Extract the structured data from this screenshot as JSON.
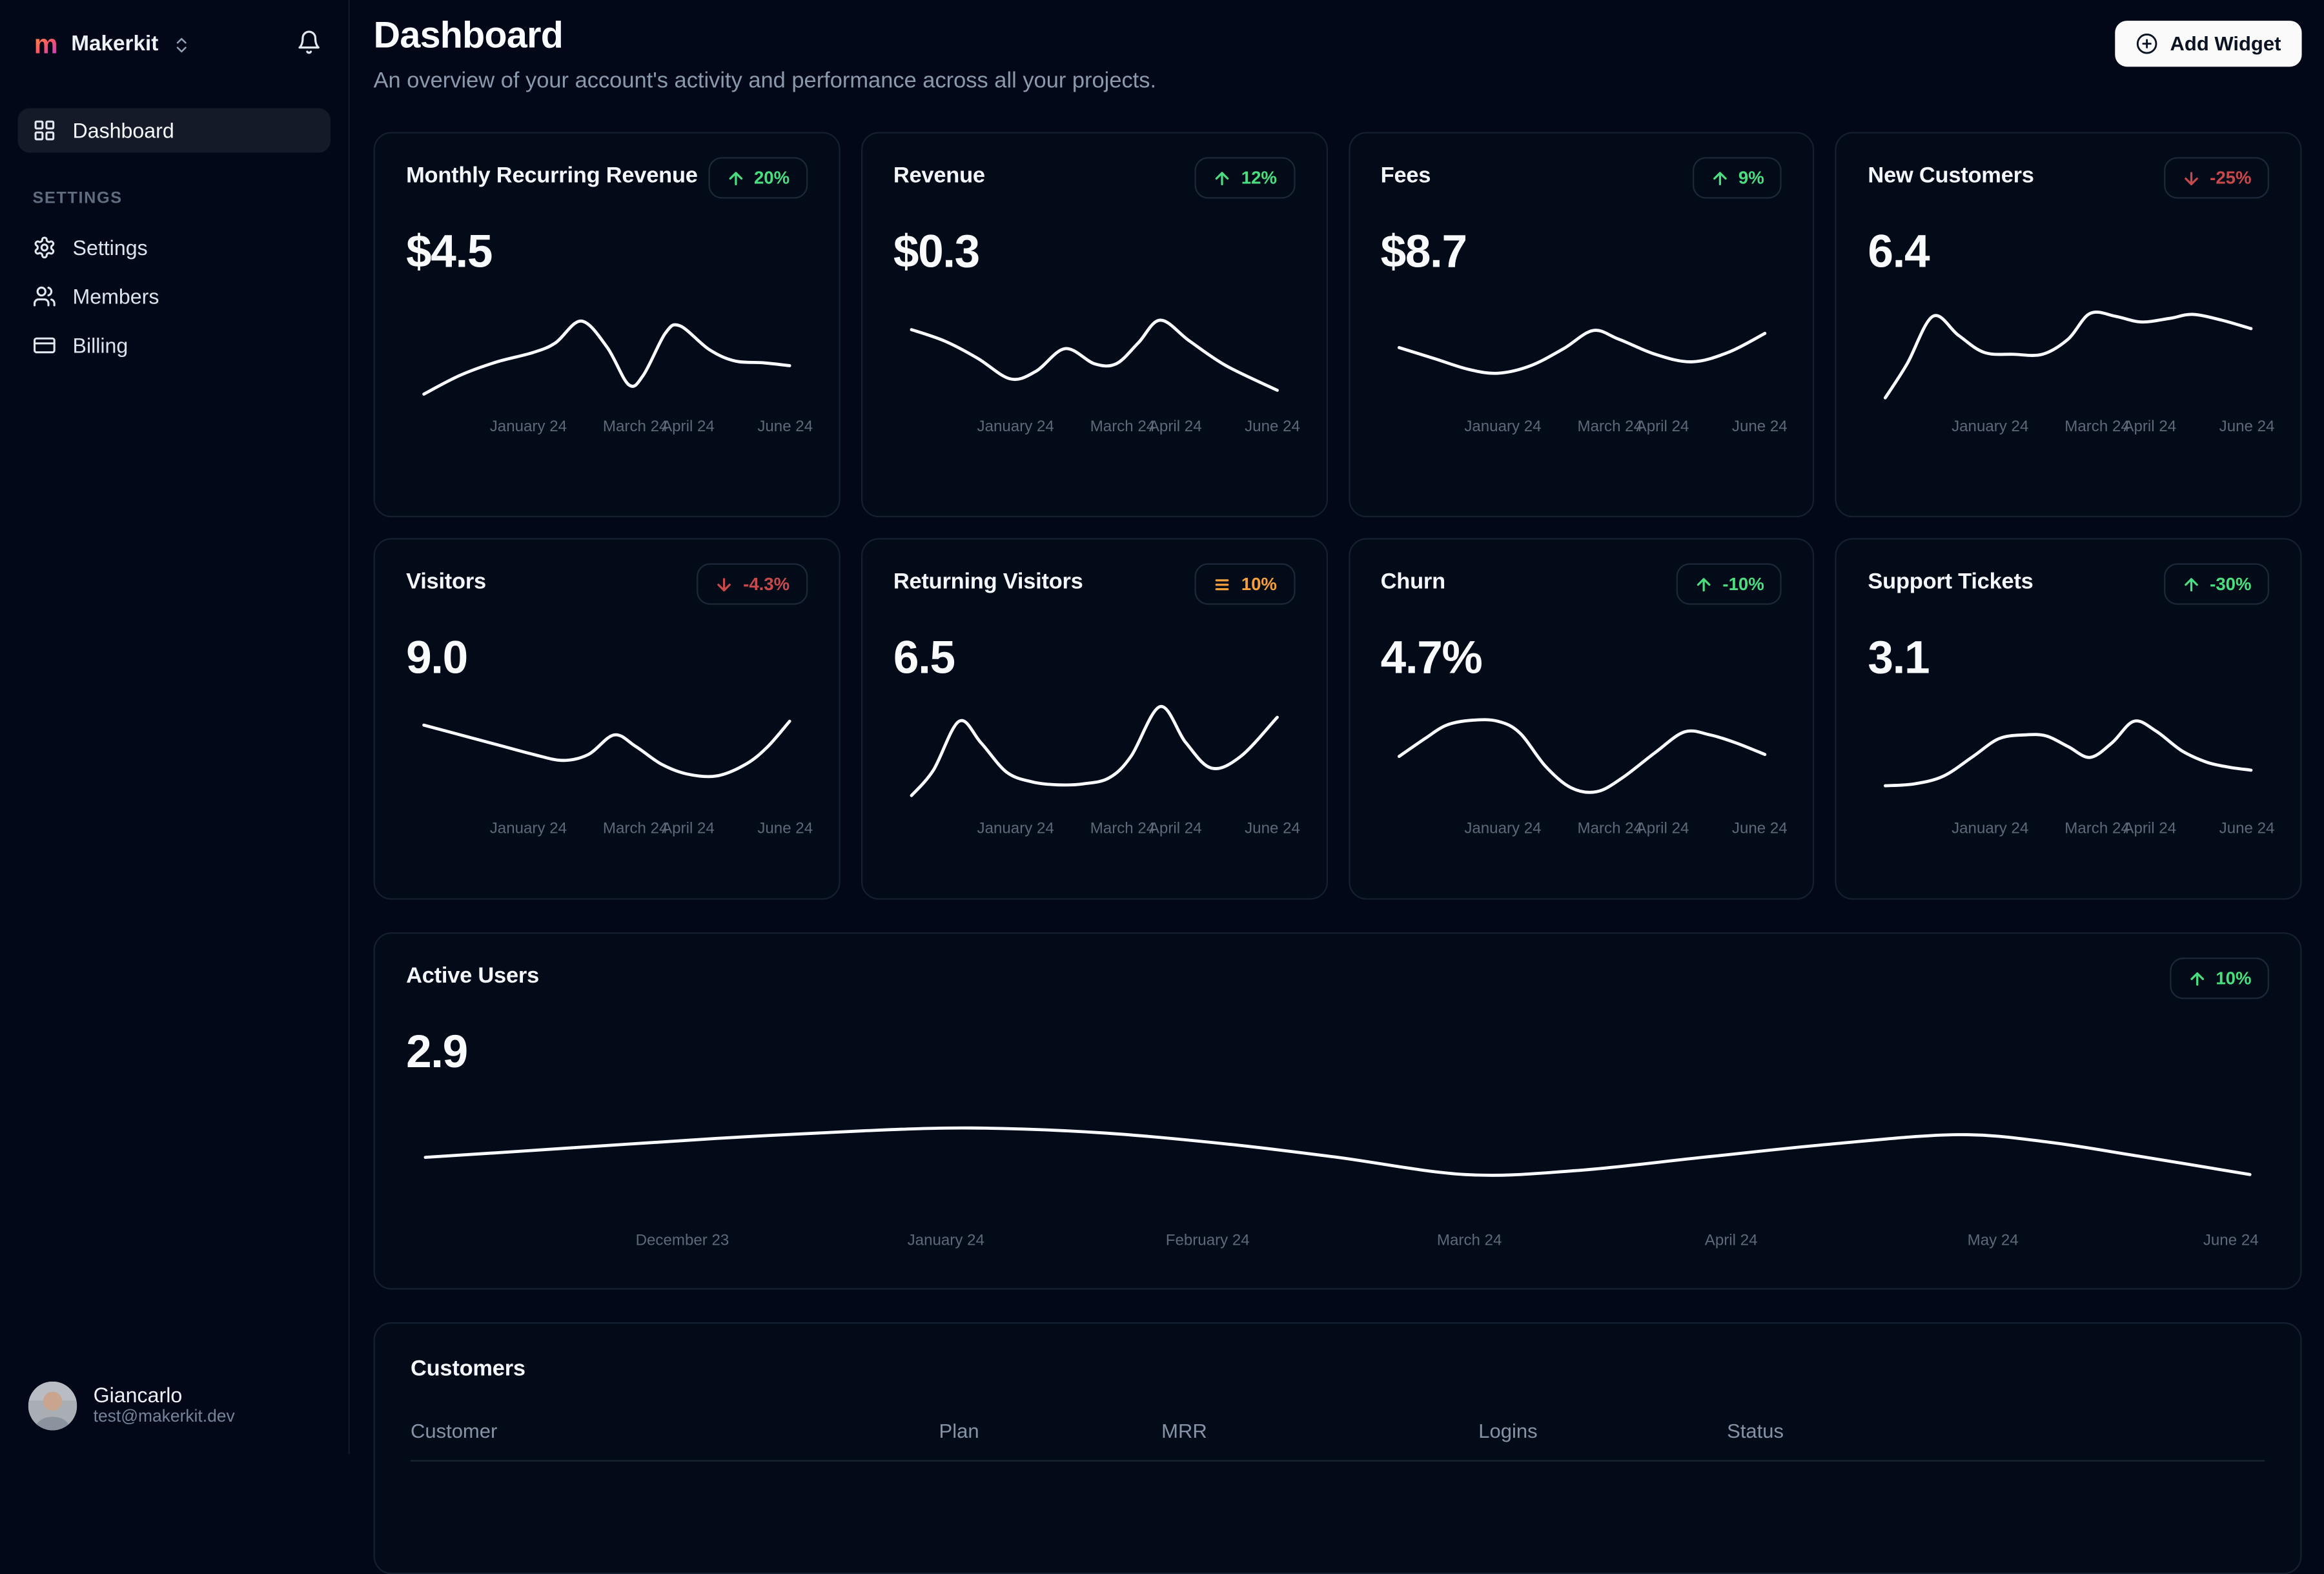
{
  "brand": {
    "name": "Makerkit",
    "logo_letter": "m"
  },
  "sidebar": {
    "nav_dashboard": "Dashboard",
    "section": "SETTINGS",
    "items": [
      "Settings",
      "Members",
      "Billing"
    ],
    "user": {
      "name": "Giancarlo",
      "email": "test@makerkit.dev"
    }
  },
  "header": {
    "title": "Dashboard",
    "subtitle": "An overview of your account's activity and performance across all your projects.",
    "add_widget": "Add Widget"
  },
  "colors": {
    "background": "#020817",
    "card_border": "#141f30",
    "line": "#fafcff",
    "green": "#4ade80",
    "red": "#c8494c",
    "orange": "#f59e3c"
  },
  "customers_table": {
    "title": "Customers",
    "columns": [
      "Customer",
      "Plan",
      "MRR",
      "Logins",
      "Status"
    ]
  },
  "chart_data": [
    {
      "id": "mrr",
      "type": "line",
      "title": "Monthly Recurring Revenue",
      "value": "$4.5",
      "trend": {
        "label": "20%",
        "icon": "arrow-up",
        "color": "green"
      },
      "x_ticks": [
        "January 24",
        "March 24",
        "April 24",
        "June 24"
      ],
      "tick_pos": [
        28.9,
        57.7,
        71.9,
        98
      ],
      "ylim": [
        0,
        100
      ],
      "points": [
        [
          0,
          8
        ],
        [
          10,
          28
        ],
        [
          20,
          42
        ],
        [
          30,
          52
        ],
        [
          36,
          62
        ],
        [
          43,
          85
        ],
        [
          50,
          58
        ],
        [
          56,
          18
        ],
        [
          60,
          28
        ],
        [
          66,
          72
        ],
        [
          70,
          80
        ],
        [
          78,
          55
        ],
        [
          85,
          43
        ],
        [
          93,
          41
        ],
        [
          100,
          38
        ]
      ]
    },
    {
      "id": "revenue",
      "type": "line",
      "title": "Revenue",
      "value": "$0.3",
      "trend": {
        "label": "12%",
        "icon": "arrow-up",
        "color": "green"
      },
      "x_ticks": [
        "January 24",
        "March 24",
        "April 24",
        "June 24"
      ],
      "tick_pos": [
        28.9,
        57.7,
        71.9,
        98
      ],
      "ylim": [
        0,
        100
      ],
      "points": [
        [
          0,
          76
        ],
        [
          9,
          64
        ],
        [
          18,
          46
        ],
        [
          27,
          24
        ],
        [
          34,
          32
        ],
        [
          42,
          56
        ],
        [
          50,
          40
        ],
        [
          56,
          40
        ],
        [
          62,
          62
        ],
        [
          68,
          86
        ],
        [
          76,
          64
        ],
        [
          86,
          38
        ],
        [
          100,
          12
        ]
      ]
    },
    {
      "id": "fees",
      "type": "line",
      "title": "Fees",
      "value": "$8.7",
      "trend": {
        "label": "9%",
        "icon": "arrow-up",
        "color": "green"
      },
      "x_ticks": [
        "January 24",
        "March 24",
        "April 24",
        "June 24"
      ],
      "tick_pos": [
        28.9,
        57.7,
        71.9,
        98
      ],
      "ylim": [
        0,
        100
      ],
      "points": [
        [
          0,
          57
        ],
        [
          10,
          45
        ],
        [
          19,
          34
        ],
        [
          27,
          30
        ],
        [
          36,
          38
        ],
        [
          45,
          56
        ],
        [
          53,
          75
        ],
        [
          60,
          66
        ],
        [
          70,
          50
        ],
        [
          80,
          42
        ],
        [
          90,
          52
        ],
        [
          100,
          72
        ]
      ]
    },
    {
      "id": "new-customers",
      "type": "line",
      "title": "New Customers",
      "value": "6.4",
      "trend": {
        "label": "-25%",
        "icon": "arrow-down",
        "color": "red"
      },
      "x_ticks": [
        "January 24",
        "March 24",
        "April 24",
        "June 24"
      ],
      "tick_pos": [
        28.9,
        57.7,
        71.9,
        98
      ],
      "ylim": [
        0,
        100
      ],
      "points": [
        [
          0,
          4
        ],
        [
          6,
          40
        ],
        [
          13,
          90
        ],
        [
          20,
          70
        ],
        [
          27,
          52
        ],
        [
          35,
          50
        ],
        [
          43,
          50
        ],
        [
          50,
          66
        ],
        [
          56,
          93
        ],
        [
          63,
          90
        ],
        [
          70,
          84
        ],
        [
          78,
          88
        ],
        [
          84,
          92
        ],
        [
          92,
          86
        ],
        [
          100,
          77
        ]
      ]
    },
    {
      "id": "visitors",
      "type": "line",
      "title": "Visitors",
      "value": "9.0",
      "trend": {
        "label": "-4.3%",
        "icon": "arrow-down",
        "color": "red"
      },
      "x_ticks": [
        "January 24",
        "March 24",
        "April 24",
        "June 24"
      ],
      "tick_pos": [
        28.9,
        57.7,
        71.9,
        98
      ],
      "ylim": [
        0,
        100
      ],
      "points": [
        [
          0,
          80
        ],
        [
          10,
          70
        ],
        [
          20,
          60
        ],
        [
          30,
          50
        ],
        [
          38,
          44
        ],
        [
          45,
          50
        ],
        [
          52,
          70
        ],
        [
          58,
          58
        ],
        [
          65,
          40
        ],
        [
          72,
          30
        ],
        [
          80,
          28
        ],
        [
          88,
          40
        ],
        [
          94,
          58
        ],
        [
          100,
          84
        ]
      ]
    },
    {
      "id": "returning-visitors",
      "type": "line",
      "title": "Returning Visitors",
      "value": "6.5",
      "trend": {
        "label": "10%",
        "icon": "lines",
        "color": "orange"
      },
      "x_ticks": [
        "January 24",
        "March 24",
        "April 24",
        "June 24"
      ],
      "tick_pos": [
        28.9,
        57.7,
        71.9,
        98
      ],
      "ylim": [
        0,
        100
      ],
      "points": [
        [
          0,
          8
        ],
        [
          6,
          34
        ],
        [
          13,
          84
        ],
        [
          19,
          62
        ],
        [
          26,
          32
        ],
        [
          33,
          22
        ],
        [
          40,
          19
        ],
        [
          47,
          20
        ],
        [
          54,
          26
        ],
        [
          60,
          48
        ],
        [
          68,
          99
        ],
        [
          75,
          62
        ],
        [
          82,
          36
        ],
        [
          90,
          48
        ],
        [
          100,
          88
        ]
      ]
    },
    {
      "id": "churn",
      "type": "line",
      "title": "Churn",
      "value": "4.7%",
      "trend": {
        "label": "-10%",
        "icon": "arrow-up",
        "color": "green"
      },
      "x_ticks": [
        "January 24",
        "March 24",
        "April 24",
        "June 24"
      ],
      "tick_pos": [
        28.9,
        57.7,
        71.9,
        98
      ],
      "ylim": [
        0,
        100
      ],
      "points": [
        [
          0,
          48
        ],
        [
          7,
          66
        ],
        [
          13,
          80
        ],
        [
          20,
          85
        ],
        [
          27,
          84
        ],
        [
          33,
          72
        ],
        [
          40,
          38
        ],
        [
          47,
          16
        ],
        [
          54,
          12
        ],
        [
          61,
          26
        ],
        [
          70,
          52
        ],
        [
          78,
          73
        ],
        [
          85,
          70
        ],
        [
          92,
          62
        ],
        [
          100,
          50
        ]
      ]
    },
    {
      "id": "support-tickets",
      "type": "line",
      "title": "Support Tickets",
      "value": "3.1",
      "trend": {
        "label": "-30%",
        "icon": "arrow-up",
        "color": "green"
      },
      "x_ticks": [
        "January 24",
        "March 24",
        "April 24",
        "June 24"
      ],
      "tick_pos": [
        28.9,
        57.7,
        71.9,
        98
      ],
      "ylim": [
        0,
        100
      ],
      "points": [
        [
          0,
          18
        ],
        [
          8,
          20
        ],
        [
          16,
          28
        ],
        [
          24,
          48
        ],
        [
          31,
          66
        ],
        [
          38,
          70
        ],
        [
          44,
          69
        ],
        [
          50,
          58
        ],
        [
          56,
          47
        ],
        [
          62,
          62
        ],
        [
          68,
          84
        ],
        [
          74,
          74
        ],
        [
          81,
          54
        ],
        [
          88,
          42
        ],
        [
          94,
          37
        ],
        [
          100,
          34
        ]
      ]
    },
    {
      "id": "active-users",
      "type": "line",
      "title": "Active Users",
      "value": "2.9",
      "trend": {
        "label": "10%",
        "icon": "arrow-up",
        "color": "green"
      },
      "x_ticks": [
        "December 23",
        "January 24",
        "February 24",
        "March 24",
        "April 24",
        "May 24",
        "June 24"
      ],
      "tick_pos": [
        14.2,
        28.6,
        42.9,
        57.2,
        71.5,
        85.8,
        98.8
      ],
      "ylim": [
        0,
        100
      ],
      "points": [
        [
          0,
          44
        ],
        [
          8,
          54
        ],
        [
          16,
          64
        ],
        [
          24,
          72
        ],
        [
          30,
          75
        ],
        [
          37,
          70
        ],
        [
          44,
          58
        ],
        [
          50,
          44
        ],
        [
          57,
          26
        ],
        [
          63,
          30
        ],
        [
          70,
          44
        ],
        [
          77,
          58
        ],
        [
          84,
          68
        ],
        [
          89,
          60
        ],
        [
          94,
          45
        ],
        [
          100,
          26
        ]
      ]
    }
  ]
}
